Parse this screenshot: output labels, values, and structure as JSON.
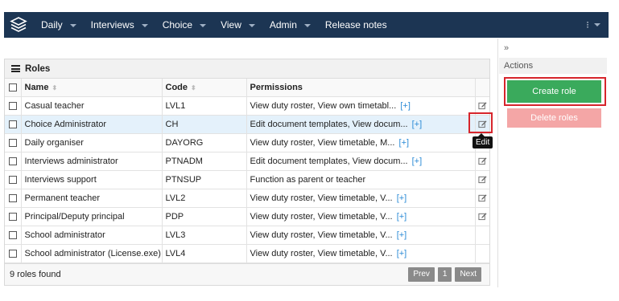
{
  "nav": {
    "items": [
      {
        "label": "Daily",
        "has_caret": true
      },
      {
        "label": "Interviews",
        "has_caret": true
      },
      {
        "label": "Choice",
        "has_caret": true
      },
      {
        "label": "View",
        "has_caret": true
      },
      {
        "label": "Admin",
        "has_caret": true
      },
      {
        "label": "Release notes",
        "has_caret": false
      }
    ],
    "more_glyph": "⁝",
    "colors": {
      "background": "#1c3553",
      "text": "#ffffff"
    }
  },
  "roles_panel": {
    "title": "Roles",
    "columns": {
      "name": "Name",
      "code": "Code",
      "permissions": "Permissions"
    },
    "more_link": "[+]",
    "rows": [
      {
        "name": "Casual teacher",
        "code": "LVL1",
        "permissions": "View duty roster, View own timetabl...",
        "has_more": true,
        "editable": true,
        "selected": false
      },
      {
        "name": "Choice Administrator",
        "code": "CH",
        "permissions": "Edit document templates, View docum...",
        "has_more": true,
        "editable": true,
        "selected": true
      },
      {
        "name": "Daily organiser",
        "code": "DAYORG",
        "permissions": "View duty roster, View timetable, M...",
        "has_more": true,
        "editable": false,
        "selected": false
      },
      {
        "name": "Interviews administrator",
        "code": "PTNADM",
        "permissions": "Edit document templates, View docum...",
        "has_more": true,
        "editable": true,
        "selected": false
      },
      {
        "name": "Interviews support",
        "code": "PTNSUP",
        "permissions": "Function as parent or teacher",
        "has_more": false,
        "editable": true,
        "selected": false
      },
      {
        "name": "Permanent teacher",
        "code": "LVL2",
        "permissions": "View duty roster, View timetable, V...",
        "has_more": true,
        "editable": true,
        "selected": false
      },
      {
        "name": "Principal/Deputy principal",
        "code": "PDP",
        "permissions": "View duty roster, View timetable, V...",
        "has_more": true,
        "editable": true,
        "selected": false
      },
      {
        "name": "School administrator",
        "code": "LVL3",
        "permissions": "View duty roster, View timetable, V...",
        "has_more": true,
        "editable": false,
        "selected": false
      },
      {
        "name": "School administrator (License.exe)",
        "code": "LVL4",
        "permissions": "View duty roster, View timetable, V...",
        "has_more": true,
        "editable": false,
        "selected": false
      }
    ],
    "footer": {
      "count_text": "9 roles found",
      "prev": "Prev",
      "page": "1",
      "next": "Next"
    },
    "tooltip": "Edit"
  },
  "sidebar": {
    "collapse_glyph": "»",
    "actions_title": "Actions",
    "create_label": "Create role",
    "delete_label": "Delete roles",
    "colors": {
      "create": "#3aaa5c",
      "delete": "#f4a6a6",
      "highlight": "#d6252c"
    }
  }
}
